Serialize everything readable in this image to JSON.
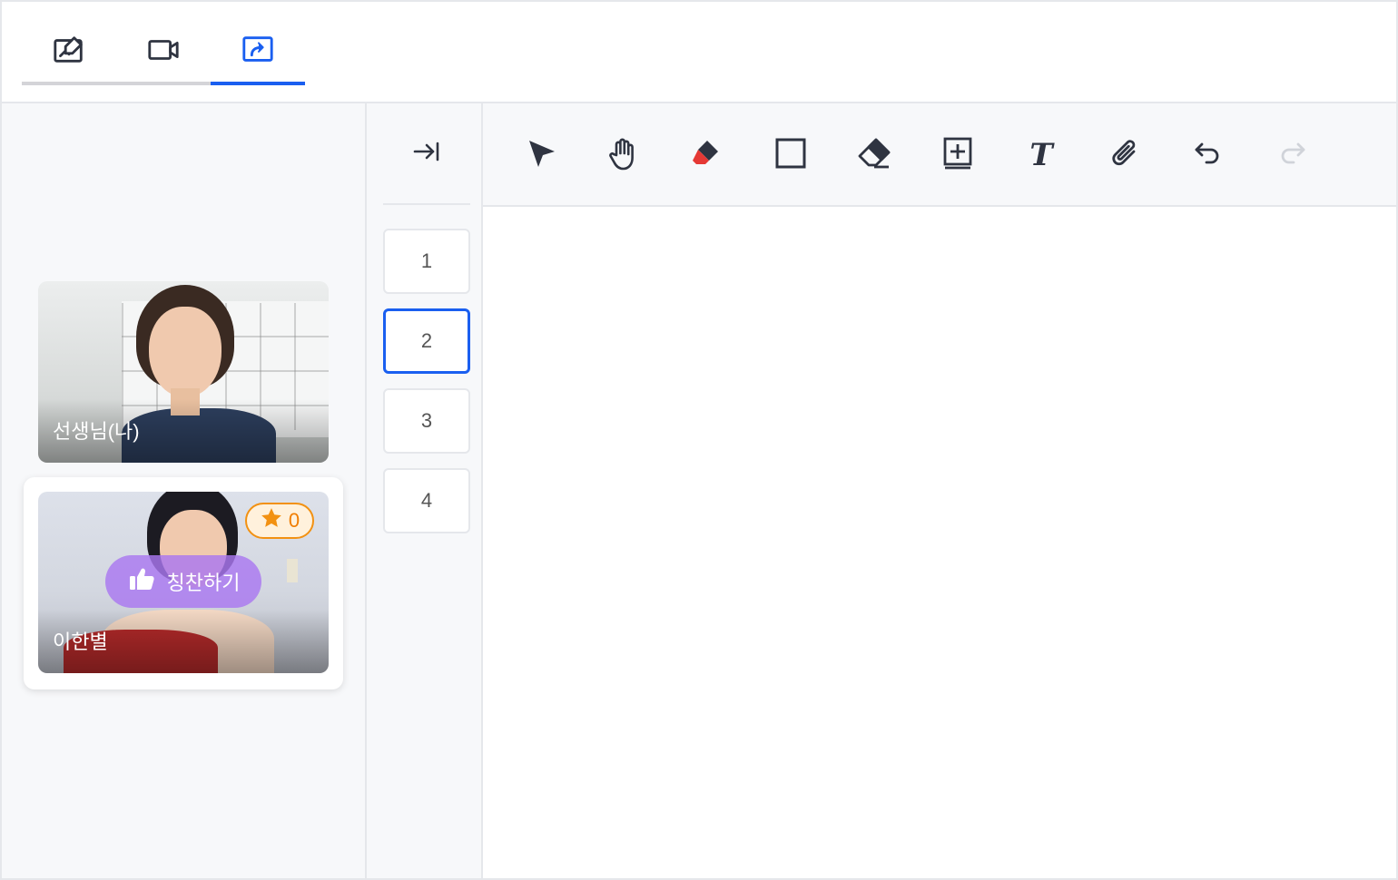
{
  "top_tabs": [
    {
      "icon": "whiteboard-icon",
      "active": false
    },
    {
      "icon": "video-camera-icon",
      "active": false
    },
    {
      "icon": "screen-share-icon",
      "active": true
    }
  ],
  "colors": {
    "accent": "#1a5ff0",
    "star": "#f29112",
    "praise": "#aa78f0",
    "icon": "#2f3441",
    "marker": "#e53935"
  },
  "participants": {
    "teacher": {
      "name": "선생님(나)"
    },
    "student": {
      "name": "이한별",
      "stars": "0",
      "praise_label": "칭찬하기"
    }
  },
  "pages": [
    "1",
    "2",
    "3",
    "4"
  ],
  "active_page": "2",
  "toolbar": [
    "select-arrow-icon",
    "hand-icon",
    "highlighter-icon",
    "rectangle-icon",
    "eraser-icon",
    "add-page-icon",
    "text-icon",
    "attach-icon",
    "undo-icon",
    "redo-icon"
  ]
}
